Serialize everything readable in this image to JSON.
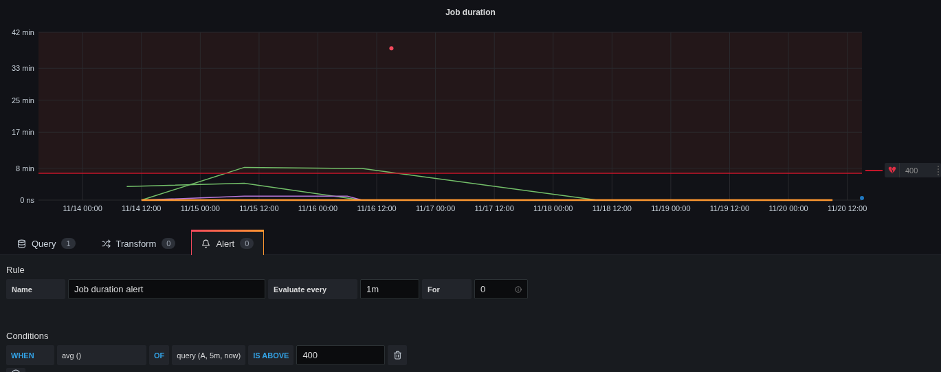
{
  "panel": {
    "title": "Job duration",
    "chart_data": {
      "type": "line",
      "categories": [
        null,
        null,
        null,
        "11/14 00:00",
        null,
        null,
        null,
        "11/14 12:00",
        null,
        null,
        null,
        "11/15 00:00",
        null,
        null,
        null,
        "11/15 12:00",
        null,
        null,
        null,
        "11/16 00:00",
        null,
        null,
        null,
        "11/16 12:00",
        null,
        null,
        null,
        "11/17 00:00",
        null,
        null,
        null,
        "11/17 12:00",
        null,
        null,
        null,
        "11/18 00:00",
        null,
        null,
        null,
        "11/18 12:00",
        null,
        null,
        null,
        "11/19 00:00",
        null,
        null,
        null,
        "11/19 12:00",
        null,
        null,
        null,
        "11/20 00:00",
        null,
        null,
        null,
        "11/20 12:00",
        null
      ],
      "series": [
        {
          "color": "#73bf69",
          "values": [
            null,
            null,
            null,
            null,
            null,
            null,
            null,
            0,
            null,
            null,
            null,
            null,
            null,
            null,
            8.2,
            null,
            null,
            null,
            null,
            null,
            null,
            null,
            7.9,
            null,
            null,
            null,
            null,
            null,
            null,
            null,
            null,
            null,
            null,
            null,
            null,
            null,
            null,
            null,
            0,
            null,
            null,
            null,
            null,
            null,
            null,
            null,
            null,
            null,
            null,
            null,
            null,
            null,
            null,
            null,
            null,
            null,
            null
          ]
        },
        {
          "color": "#73bf69",
          "values": [
            null,
            null,
            null,
            null,
            null,
            null,
            3.4,
            null,
            null,
            null,
            null,
            null,
            null,
            null,
            4.2,
            null,
            null,
            null,
            null,
            null,
            null,
            null,
            0,
            null,
            null,
            null,
            null,
            null,
            null,
            null,
            null,
            null,
            null,
            null,
            null,
            null,
            null,
            null,
            null,
            null,
            null,
            null,
            null,
            null,
            null,
            null,
            null,
            null,
            null,
            null,
            null,
            null,
            null,
            null,
            null,
            null,
            null
          ]
        },
        {
          "color": "#b877d9",
          "values": [
            null,
            null,
            null,
            null,
            null,
            null,
            null,
            0,
            null,
            null,
            null,
            null,
            null,
            null,
            1.0,
            null,
            null,
            null,
            null,
            null,
            null,
            1.0,
            0,
            null,
            null,
            null,
            null,
            null,
            null,
            null,
            null,
            null,
            null,
            null,
            null,
            null,
            null,
            null,
            null,
            null,
            null,
            null,
            null,
            null,
            null,
            null,
            null,
            null,
            null,
            null,
            null,
            null,
            null,
            null,
            null,
            null,
            null
          ]
        },
        {
          "color": "#ff9830",
          "values": [
            null,
            null,
            null,
            null,
            null,
            null,
            null,
            0,
            null,
            null,
            null,
            null,
            null,
            null,
            null,
            null,
            null,
            null,
            null,
            null,
            null,
            null,
            null,
            null,
            null,
            null,
            null,
            null,
            null,
            null,
            null,
            null,
            null,
            null,
            null,
            null,
            null,
            null,
            null,
            null,
            null,
            null,
            null,
            null,
            null,
            null,
            null,
            null,
            null,
            null,
            null,
            null,
            null,
            null,
            0,
            null,
            null
          ]
        },
        {
          "color": "#f2495c",
          "marker": true,
          "values": [
            null,
            null,
            null,
            null,
            null,
            null,
            null,
            null,
            null,
            null,
            null,
            null,
            null,
            null,
            null,
            null,
            null,
            null,
            null,
            null,
            null,
            null,
            null,
            null,
            38,
            null,
            null,
            null,
            null,
            null,
            null,
            null,
            null,
            null,
            null,
            null,
            null,
            null,
            null,
            null,
            null,
            null,
            null,
            null,
            null,
            null,
            null,
            null,
            null,
            null,
            null,
            null,
            null,
            null,
            null,
            null,
            null
          ]
        },
        {
          "color": "#1f78c1",
          "marker": true,
          "values": [
            null,
            null,
            null,
            null,
            null,
            null,
            null,
            null,
            null,
            null,
            null,
            null,
            null,
            null,
            null,
            null,
            null,
            null,
            null,
            null,
            null,
            null,
            null,
            null,
            null,
            null,
            null,
            null,
            null,
            null,
            null,
            null,
            null,
            null,
            null,
            null,
            null,
            null,
            null,
            null,
            null,
            null,
            null,
            null,
            null,
            null,
            null,
            null,
            null,
            null,
            null,
            null,
            null,
            null,
            null,
            null,
            0.5
          ]
        },
        {
          "color": "#c4162a",
          "values": [
            6.7,
            null,
            null,
            null,
            null,
            null,
            null,
            null,
            null,
            null,
            null,
            null,
            null,
            null,
            null,
            null,
            null,
            null,
            null,
            null,
            null,
            null,
            null,
            null,
            null,
            null,
            null,
            null,
            null,
            null,
            null,
            null,
            null,
            null,
            null,
            null,
            null,
            null,
            null,
            null,
            null,
            null,
            null,
            null,
            null,
            null,
            null,
            null,
            null,
            null,
            null,
            null,
            null,
            null,
            null,
            null,
            6.7
          ]
        }
      ],
      "ylim": [
        0,
        42
      ],
      "yticks": [
        {
          "value": 0,
          "label": "0 ns"
        },
        {
          "value": 8,
          "label": "8 min"
        },
        {
          "value": 17,
          "label": "17 min"
        },
        {
          "value": 25,
          "label": "25 min"
        },
        {
          "value": 33,
          "label": "33 min"
        },
        {
          "value": 42,
          "label": "42 min"
        }
      ],
      "grid": true
    }
  },
  "threshold_handle": {
    "value": "400"
  },
  "tabs": [
    {
      "label": "Query",
      "count": "1",
      "selected": false
    },
    {
      "label": "Transform",
      "count": "0",
      "selected": false
    },
    {
      "label": "Alert",
      "count": "0",
      "selected": true
    }
  ],
  "rule": {
    "heading": "Rule",
    "fields": [
      {
        "label": "Name",
        "value": "Job duration alert"
      },
      {
        "label": "Evaluate every",
        "value": "1m"
      },
      {
        "label": "For",
        "value": "0",
        "info": true
      }
    ]
  },
  "conditions": {
    "heading": "Conditions",
    "parts": [
      {
        "kind": "keyword",
        "text": "WHEN"
      },
      {
        "kind": "select",
        "text": "avg ()"
      },
      {
        "kind": "keyword",
        "text": "OF"
      },
      {
        "kind": "select",
        "text": "query (A, 5m, now)"
      },
      {
        "kind": "keyword",
        "text": "IS ABOVE"
      },
      {
        "kind": "input",
        "text": "400"
      },
      {
        "kind": "delete"
      }
    ]
  }
}
